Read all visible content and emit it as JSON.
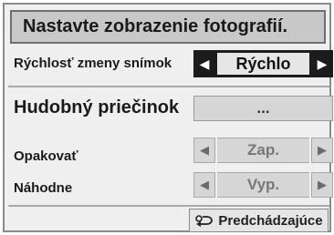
{
  "dialog": {
    "title": "Nastavte zobrazenie fotografií."
  },
  "slide_speed": {
    "label": "Rýchlosť zmeny snímok",
    "value": "Rýchlo",
    "left_arrow": "◀",
    "right_arrow": "▶"
  },
  "music_folder": {
    "label": "Hudobný priečinok",
    "value": "..."
  },
  "repeat": {
    "label": "Opakovať",
    "value": "Zap.",
    "left_arrow": "◀",
    "right_arrow": "▶"
  },
  "random": {
    "label": "Náhodne",
    "value": "Vyp.",
    "left_arrow": "◀",
    "right_arrow": "▶"
  },
  "back_button": {
    "label": "Predchádzajúce",
    "icon": "return-icon"
  }
}
